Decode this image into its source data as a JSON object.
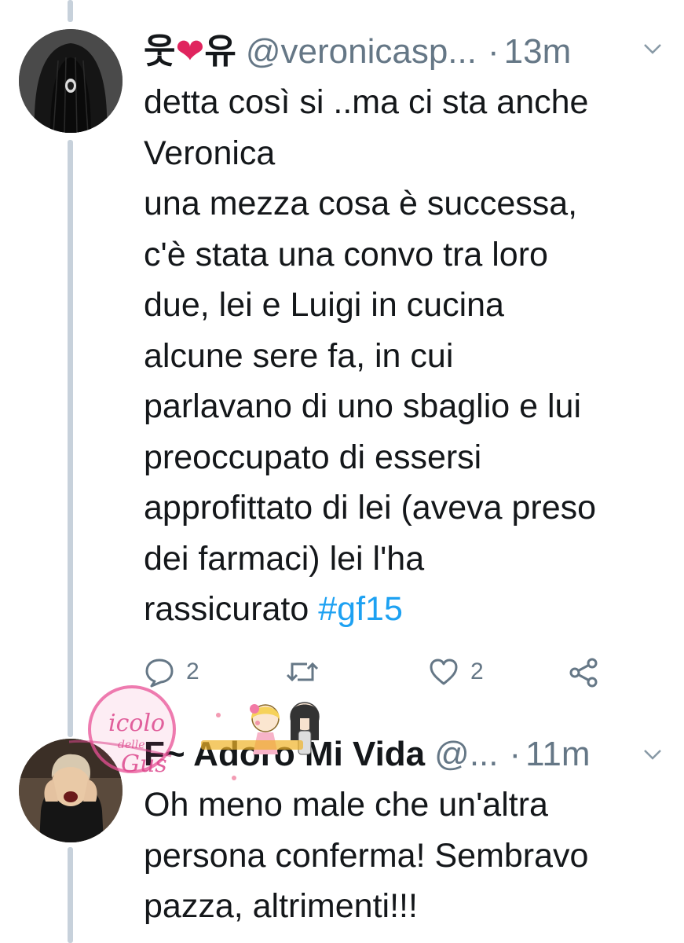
{
  "tweets": [
    {
      "display_name": "웃❤유",
      "handle": "@veronicasp...",
      "separator": "·",
      "time": "13m",
      "lines": [
        "detta così si ..ma ci sta anche",
        "Veronica",
        "una mezza cosa è successa,",
        "c'è stata una convo tra loro",
        "due, lei e Luigi in cucina",
        "alcune sere fa, in cui",
        "parlavano di uno sbaglio e lui",
        "preoccupato di essersi",
        "approfittato di lei (aveva preso",
        "dei farmaci) lei l'ha"
      ],
      "last_line_text": "rassicurato ",
      "hashtag": "#gf15",
      "reply_count": "2",
      "retweet_count": "",
      "like_count": "2"
    },
    {
      "display_name": "F~ Adoro Mi Vida",
      "handle": "@...",
      "separator": "·",
      "time": "11m",
      "lines": [
        "Oh meno male che un'altra",
        "persona conferma! Sembravo",
        "pazza, altrimenti!!!"
      ]
    }
  ],
  "watermark": {
    "line1": "icolo",
    "line2": "delle",
    "line3": "Gus"
  },
  "colors": {
    "link": "#1da1f2",
    "secondary_text": "#657786",
    "thread_line": "#c7d1db",
    "heart": "#e0245e"
  }
}
